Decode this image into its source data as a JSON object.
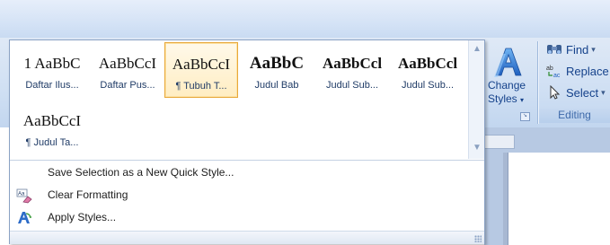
{
  "gallery": {
    "styles": [
      {
        "preview": "1 AaBbC",
        "name": "Daftar Ilus...",
        "selected": false,
        "weight": "normal"
      },
      {
        "preview": "AaBbCcI",
        "name": "Daftar Pus...",
        "selected": false,
        "weight": "normal"
      },
      {
        "preview": "AaBbCcI",
        "name": "¶ Tubuh T...",
        "selected": true,
        "weight": "normal"
      },
      {
        "preview": "AaBbC",
        "name": "Judul Bab",
        "selected": false,
        "weight": "bold-big"
      },
      {
        "preview": "AaBbCcl",
        "name": "Judul Sub...",
        "selected": false,
        "weight": "bold"
      },
      {
        "preview": "AaBbCcl",
        "name": "Judul Sub...",
        "selected": false,
        "weight": "bold"
      },
      {
        "preview": "AaBbCcI",
        "name": "¶ Judul Ta...",
        "selected": false,
        "weight": "normal"
      }
    ]
  },
  "menu": {
    "save_selection": "Save Selection as a New Quick Style...",
    "clear_formatting": "Clear Formatting",
    "apply_styles": "Apply Styles..."
  },
  "ribbon": {
    "change_styles_line1": "Change",
    "change_styles_line2": "Styles",
    "find": "Find",
    "replace": "Replace",
    "select": "Select",
    "editing_group": "Editing"
  },
  "colors": {
    "selected_border": "#e8a83a",
    "ribbon_text": "#15428b",
    "panel_border": "#8ba2c4"
  }
}
